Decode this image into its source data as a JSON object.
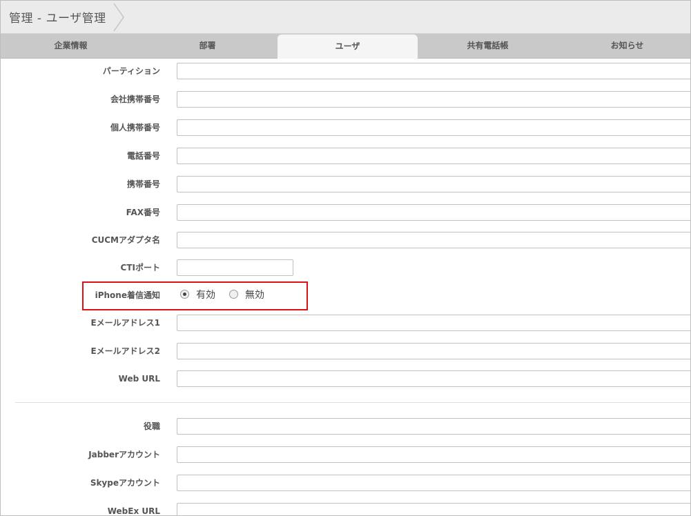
{
  "header": {
    "title": "管理 - ユーザ管理"
  },
  "tabs": [
    {
      "label": "企業情報"
    },
    {
      "label": "部署"
    },
    {
      "label": "ユーザ",
      "active": true
    },
    {
      "label": "共有電話帳"
    },
    {
      "label": "お知らせ"
    }
  ],
  "form": {
    "partition_label": "パーティション",
    "company_mobile_label": "会社携帯番号",
    "personal_mobile_label": "個人携帯番号",
    "phone_label": "電話番号",
    "mobile_label": "携帯番号",
    "fax_label": "FAX番号",
    "cucm_adapter_label": "CUCMアダプタ名",
    "cti_port_label": "CTIポート",
    "iphone_notify_label": "iPhone着信通知",
    "iphone_notify_options": [
      {
        "label": "有効",
        "checked": true
      },
      {
        "label": "無効",
        "checked": false
      }
    ],
    "email1_label": "Eメールアドレス1",
    "email2_label": "Eメールアドレス2",
    "web_url_label": "Web URL",
    "position_label": "役職",
    "jabber_label": "Jabberアカウント",
    "skype_label": "Skypeアカウント",
    "webex_label": "WebEx URL"
  },
  "colors": {
    "highlight": "#dd1111",
    "tab_bar": "#c9c9c9",
    "active_tab": "#f5f5f5",
    "title_bar": "#ebebeb"
  }
}
